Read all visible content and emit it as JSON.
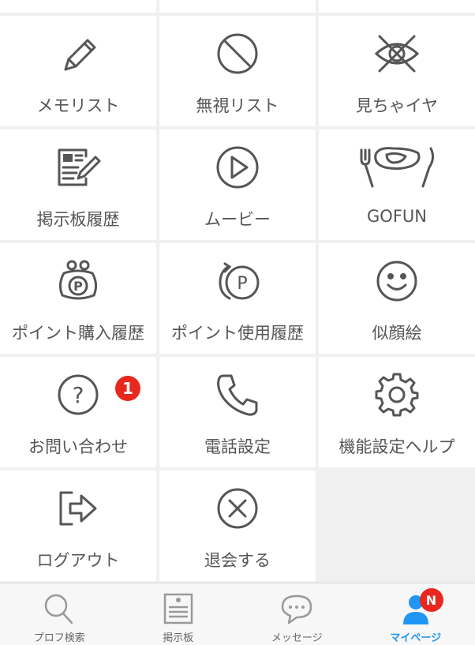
{
  "menu": {
    "memo_list": "メモリスト",
    "ignore_list": "無視リスト",
    "seen_dislike": "見ちゃイヤ",
    "board_history": "掲示板履歴",
    "movie": "ムービー",
    "gofun": "GOFUN",
    "point_purchase_history": "ポイント購入履歴",
    "point_usage_history": "ポイント使用履歴",
    "portrait": "似顔絵",
    "contact": "お問い合わせ",
    "contact_badge": "1",
    "phone_settings": "電話設定",
    "feature_settings_help": "機能設定ヘルプ",
    "logout": "ログアウト",
    "withdraw": "退会する"
  },
  "tabbar": {
    "profile_search": "プロフ検索",
    "board": "掲示板",
    "message": "メッセージ",
    "mypage": "マイページ",
    "mypage_badge": "N"
  },
  "colors": {
    "icon_stroke": "#555555",
    "badge_red": "#e8281f",
    "active_tab": "#2196f3",
    "inactive_icon": "#999999"
  }
}
